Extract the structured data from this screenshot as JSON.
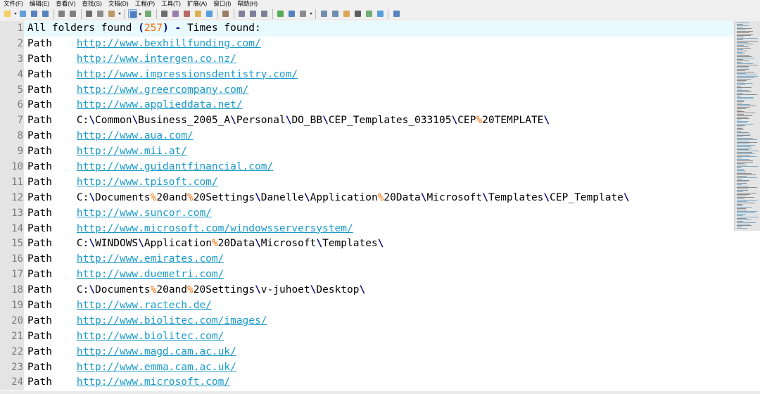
{
  "menu": [
    "文件(F)",
    "编辑(E)",
    "查看(V)",
    "查找(S)",
    "文档(D)",
    "工程(P)",
    "工具(T)",
    "扩展(A)",
    "窗口(I)",
    "帮助(H)"
  ],
  "toolbar_icons": [
    {
      "name": "new-file-icon",
      "color": "#f2c94c",
      "dd": true
    },
    {
      "name": "open-file-icon",
      "color": "#4a8fd9"
    },
    {
      "name": "save-icon",
      "color": "#3b6fb6"
    },
    {
      "name": "save-all-icon",
      "color": "#3b6fb6"
    },
    {
      "sep": true
    },
    {
      "name": "undo-icon",
      "color": "#6b6b6b"
    },
    {
      "name": "redo-icon",
      "color": "#6b6b6b"
    },
    {
      "sep": true
    },
    {
      "name": "cut-icon",
      "color": "#555555"
    },
    {
      "name": "copy-icon",
      "color": "#7a7a7a"
    },
    {
      "name": "paste-icon",
      "color": "#b08a4a",
      "dd": true
    },
    {
      "sep": true
    },
    {
      "name": "word-wrap-icon",
      "color": "#3b6fb6",
      "active": true,
      "dd": true
    },
    {
      "name": "column-mode-icon",
      "color": "#5aa05a"
    },
    {
      "sep": true
    },
    {
      "name": "find-icon",
      "color": "#555555"
    },
    {
      "name": "find-in-files-icon",
      "color": "#8a6aa0"
    },
    {
      "name": "replace-icon",
      "color": "#b05050"
    },
    {
      "name": "mark-icon",
      "color": "#d9a53b"
    },
    {
      "name": "bookmark-icon",
      "color": "#3b8fd9"
    },
    {
      "sep": true
    },
    {
      "name": "format-icon",
      "color": "#8a6a4a"
    },
    {
      "sep": true
    },
    {
      "name": "run-icon",
      "color": "#6a6a8a"
    },
    {
      "name": "debug-icon",
      "color": "#6a6a8a"
    },
    {
      "name": "macro-icon",
      "color": "#6a6a8a"
    },
    {
      "sep": true
    },
    {
      "name": "plugin-icon",
      "color": "#3ba03b"
    },
    {
      "name": "window-icon",
      "color": "#3b6fb6"
    },
    {
      "name": "tools-icon",
      "color": "#7a7a7a",
      "dd": true
    },
    {
      "sep": true
    },
    {
      "name": "panel-left-icon",
      "color": "#5a7aa0"
    },
    {
      "name": "panel-split-icon",
      "color": "#5a7aa0"
    },
    {
      "name": "document-list-icon",
      "color": "#d99a3b"
    },
    {
      "name": "terminal-icon",
      "color": "#444444"
    },
    {
      "name": "grid-icon",
      "color": "#5aa05a"
    },
    {
      "name": "browser-icon",
      "color": "#3b8fd9"
    },
    {
      "sep": true
    },
    {
      "name": "help-chat-icon",
      "color": "#3b6fb6"
    }
  ],
  "header_line": {
    "prefix": "All folders found ",
    "count": "257",
    "suffix": " Times found:"
  },
  "lines": [
    {
      "n": "2",
      "label": "Path",
      "value": "http://www.bexhillfunding.com/",
      "type": "url"
    },
    {
      "n": "3",
      "label": "Path",
      "value": "http://www.intergen.co.nz/",
      "type": "url"
    },
    {
      "n": "4",
      "label": "Path",
      "value": "http://www.impressionsdentistry.com/",
      "type": "url"
    },
    {
      "n": "5",
      "label": "Path",
      "value": "http://www.greercompany.com/",
      "type": "url"
    },
    {
      "n": "6",
      "label": "Path",
      "value": "http://www.applieddata.net/",
      "type": "url"
    },
    {
      "n": "7",
      "label": "Path",
      "value": "C:\\Common\\Business_2005_A\\Personal\\DO_BB\\CEP_Templates_033105\\CEP%20TEMPLATE\\",
      "type": "path"
    },
    {
      "n": "8",
      "label": "Path",
      "value": "http://www.aua.com/",
      "type": "url"
    },
    {
      "n": "9",
      "label": "Path",
      "value": "http://www.mii.at/",
      "type": "url"
    },
    {
      "n": "10",
      "label": "Path",
      "value": "http://www.guidantfinancial.com/",
      "type": "url"
    },
    {
      "n": "11",
      "label": "Path",
      "value": "http://www.tpisoft.com/",
      "type": "url"
    },
    {
      "n": "12",
      "label": "Path",
      "value": "C:\\Documents%20and%20Settings\\Danelle\\Application%20Data\\Microsoft\\Templates\\CEP_Template\\",
      "type": "path"
    },
    {
      "n": "13",
      "label": "Path",
      "value": "http://www.suncor.com/",
      "type": "url"
    },
    {
      "n": "14",
      "label": "Path",
      "value": "http://www.microsoft.com/windowsserversystem/",
      "type": "url"
    },
    {
      "n": "15",
      "label": "Path",
      "value": "C:\\WINDOWS\\Application%20Data\\Microsoft\\Templates\\",
      "type": "path"
    },
    {
      "n": "16",
      "label": "Path",
      "value": "http://www.emirates.com/",
      "type": "url"
    },
    {
      "n": "17",
      "label": "Path",
      "value": "http://www.duemetri.com/",
      "type": "url"
    },
    {
      "n": "18",
      "label": "Path",
      "value": "C:\\Documents%20and%20Settings\\v-juhoet\\Desktop\\",
      "type": "path"
    },
    {
      "n": "19",
      "label": "Path",
      "value": "http://www.ractech.de/",
      "type": "url"
    },
    {
      "n": "20",
      "label": "Path",
      "value": "http://www.biolitec.com/images/",
      "type": "url"
    },
    {
      "n": "21",
      "label": "Path",
      "value": "http://www.biolitec.com/",
      "type": "url"
    },
    {
      "n": "22",
      "label": "Path",
      "value": "http://www.magd.cam.ac.uk/",
      "type": "url"
    },
    {
      "n": "23",
      "label": "Path",
      "value": "http://www.emma.cam.ac.uk/",
      "type": "url"
    },
    {
      "n": "24",
      "label": "Path",
      "value": "http://www.microsoft.com/",
      "type": "url"
    }
  ]
}
